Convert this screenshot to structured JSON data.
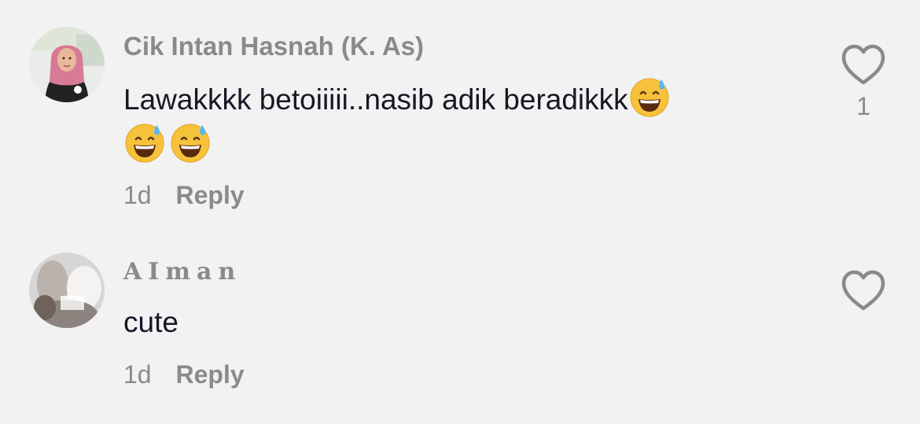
{
  "comments": [
    {
      "username": "Cik Intan Hasnah (K. As)",
      "text": "Lawakkkk betoiiiii..nasib adik beradikkk",
      "emojis": [
        "grinning-face-with-sweat",
        "grinning-face-with-sweat",
        "grinning-face-with-sweat"
      ],
      "time": "1d",
      "reply_label": "Reply",
      "like_count": "1",
      "avatar": "woman-in-pink-hijab"
    },
    {
      "username": "AIman",
      "text": "cute",
      "time": "1d",
      "reply_label": "Reply",
      "like_count": "",
      "avatar": "blurry-photo"
    }
  ],
  "colors": {
    "background": "#f2f2f3",
    "username": "#8a8a8e",
    "text": "#161823",
    "icon": "#8a8a8e"
  },
  "icons": {
    "like": "heart-outline-icon"
  }
}
